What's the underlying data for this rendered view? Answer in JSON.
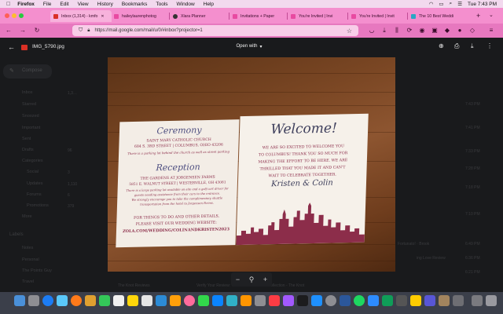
{
  "menubar": {
    "apple": "",
    "app": "Firefox",
    "items": [
      "File",
      "Edit",
      "View",
      "History",
      "Bookmarks",
      "Tools",
      "Window",
      "Help"
    ],
    "clock": "Tue 7:43 PM"
  },
  "tabs": [
    {
      "label": "Inbox (1,314) - kmfo",
      "color": "#d93025"
    },
    {
      "label": "haileylaurenphotog",
      "color": "#e84aa1"
    },
    {
      "label": "Xlara Planner",
      "color": "#333333"
    },
    {
      "label": "Invitations + Paper",
      "color": "#e84aa1"
    },
    {
      "label": "You're Invited | Invi",
      "color": "#e84aa1"
    },
    {
      "label": "You're Invited | Invit",
      "color": "#e84aa1"
    },
    {
      "label": "The 10 Best Weddi",
      "color": "#2ba7c4"
    }
  ],
  "url": "https://mail.google.com/mail/u/0/#inbox?projector=1",
  "viewer": {
    "filename": "IMG_5790.jpg",
    "open_with": "Open with"
  },
  "gmail": {
    "compose": "Compose",
    "nav": [
      {
        "label": "Inbox",
        "count": "1,3…"
      },
      {
        "label": "Starred",
        "count": ""
      },
      {
        "label": "Snoozed",
        "count": ""
      },
      {
        "label": "Important",
        "count": ""
      },
      {
        "label": "Sent",
        "count": ""
      },
      {
        "label": "Drafts",
        "count": "96"
      },
      {
        "label": "Categories",
        "count": ""
      },
      {
        "label": "Social",
        "count": "3"
      },
      {
        "label": "Updates",
        "count": "1,110"
      },
      {
        "label": "Forums",
        "count": "6"
      },
      {
        "label": "Promotions",
        "count": "379"
      },
      {
        "label": "More",
        "count": ""
      }
    ],
    "labels_heading": "Labels",
    "labels": [
      "Notes",
      "Personal",
      "The Points Guy",
      "Travel"
    ],
    "times": [
      "7:43 PM",
      "7:41 PM",
      "7:33 PM",
      "7:28 PM",
      "7:18 PM",
      "7:10 PM",
      "6:49 PM",
      "6:36 PM",
      "6:21 PM"
    ],
    "bottom_row": {
      "sender": "The Knot Reviews",
      "subject": "Verify Your Review: Vendor Name Bridal Collection - The Knot"
    },
    "right_snippet_1": "Fortunato! · Brook",
    "right_snippet_2": "ing Love Review"
  },
  "invitation": {
    "ceremony_heading": "Ceremony",
    "ceremony_place": "SAINT MARY CATHOLIC CHURCH",
    "ceremony_address": "684 S. 3RD STREET | COLUMBUS, OHIO 43206",
    "ceremony_note": "There is a parking lot behind the church as well as street parking",
    "reception_heading": "Reception",
    "reception_place": "THE GARDENS AT JORGENSEN FARMS",
    "reception_address": "5851 E. WALNUT STREET | WESTERVILLE, OH 43081",
    "reception_note_1": "There is a large parking lot available on-site and a golf cart driver for",
    "reception_note_2": "guests needing assistance from their cars to the entrance.",
    "reception_note_3": "We strongly encourage you to take the complimentary shuttle",
    "reception_note_4": "transportation from the hotel to Jorgensen Farms.",
    "more_details_1": "FOR THINGS TO DO AND OTHER DETAILS,",
    "more_details_2": "PLEASE VISIT OUR WEDDING WEBSITE:",
    "website": "ZOLA.COM/WEDDING/COLINANDKRISTEN2023",
    "welcome": "Welcome!",
    "welcome_lines": [
      "WE ARE SO EXCITED TO WELCOME YOU",
      "TO COLUMBUS! THANK YOU SO MUCH FOR",
      "MAKING THE EFFORT TO BE HERE. WE ARE",
      "THRILLED THAT YOU MADE IT AND CAN'T",
      "WAIT TO CELEBRATE TOGETHER."
    ],
    "signature": "Kristen & Colin"
  },
  "zoom": {
    "minus": "−",
    "zoom": "⚲",
    "plus": "+"
  },
  "colors": {
    "accent_tabbar": "#f48fce",
    "navbar": "#e778bf",
    "invite_red": "#8c2d4a",
    "invite_blue": "#4d4e80"
  }
}
